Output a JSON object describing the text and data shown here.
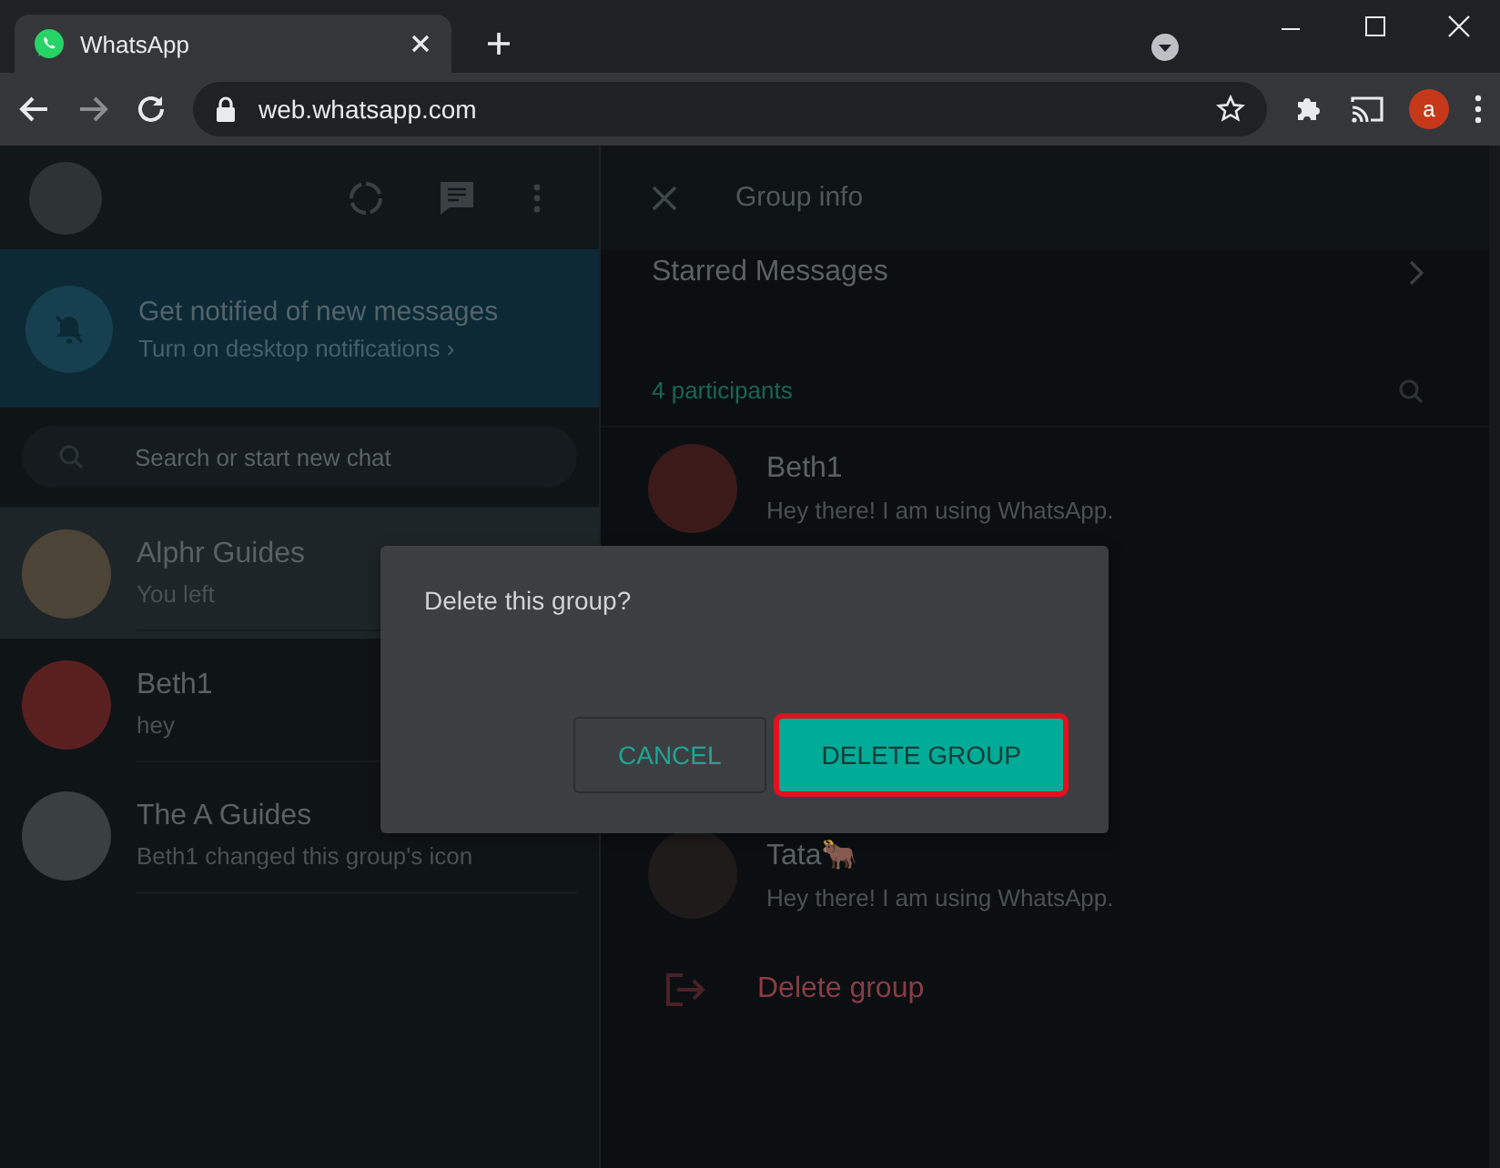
{
  "browser": {
    "tabs": [
      {
        "title": "WhatsApp",
        "selected": true
      }
    ],
    "address": "web.whatsapp.com",
    "profile_initial": "a"
  },
  "sidebar": {
    "banner": {
      "title": "Get notified of new messages",
      "subtitle": "Turn on desktop notifications ›"
    },
    "search": {
      "placeholder": "Search or start new chat"
    },
    "chats": [
      {
        "name": "Alphr Guides",
        "preview": "You left",
        "selected": true
      },
      {
        "name": "Beth1",
        "preview": "hey",
        "selected": false
      },
      {
        "name": "The A Guides",
        "preview": "Beth1 changed this group's icon",
        "selected": false
      }
    ]
  },
  "group_info": {
    "title": "Group info",
    "starred": "Starred Messages",
    "participants_label": "4 participants",
    "participants": [
      {
        "name": "Beth1",
        "about": "Hey there! I am using WhatsApp."
      },
      {
        "name": "Tata🐂",
        "about": "Hey there! I am using WhatsApp."
      }
    ],
    "delete_action": "Delete group"
  },
  "dialog": {
    "message": "Delete this group?",
    "buttons": [
      {
        "label": "CANCEL",
        "kind": "secondary",
        "highlighted": false
      },
      {
        "label": "DELETE GROUP",
        "kind": "primary",
        "highlighted": true
      }
    ]
  }
}
